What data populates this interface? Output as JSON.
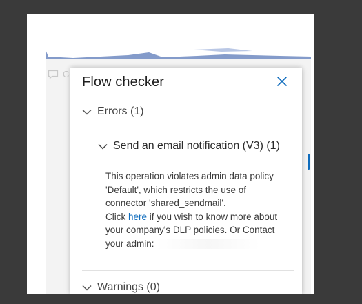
{
  "background": {
    "comment_label": "Co"
  },
  "panel": {
    "title": "Flow checker",
    "close_icon": "close-icon",
    "errors_header": "Errors (1)",
    "action_header": "Send an email notification (V3) (1)",
    "message": {
      "line1": "This operation violates admin data policy",
      "line2": "'Default', which restricts the use of",
      "line3": "connector 'shared_sendmail'.",
      "click_prefix": "Click ",
      "link_text": "here",
      "click_suffix": " if you wish to know more about",
      "line5": "your company's DLP policies. Or Contact",
      "line6": "your admin:"
    },
    "warnings_header": "Warnings (0)"
  },
  "colors": {
    "accent": "#0f6cbd",
    "page_bg": "#3a3a3a",
    "text": "#1f1f1f"
  }
}
